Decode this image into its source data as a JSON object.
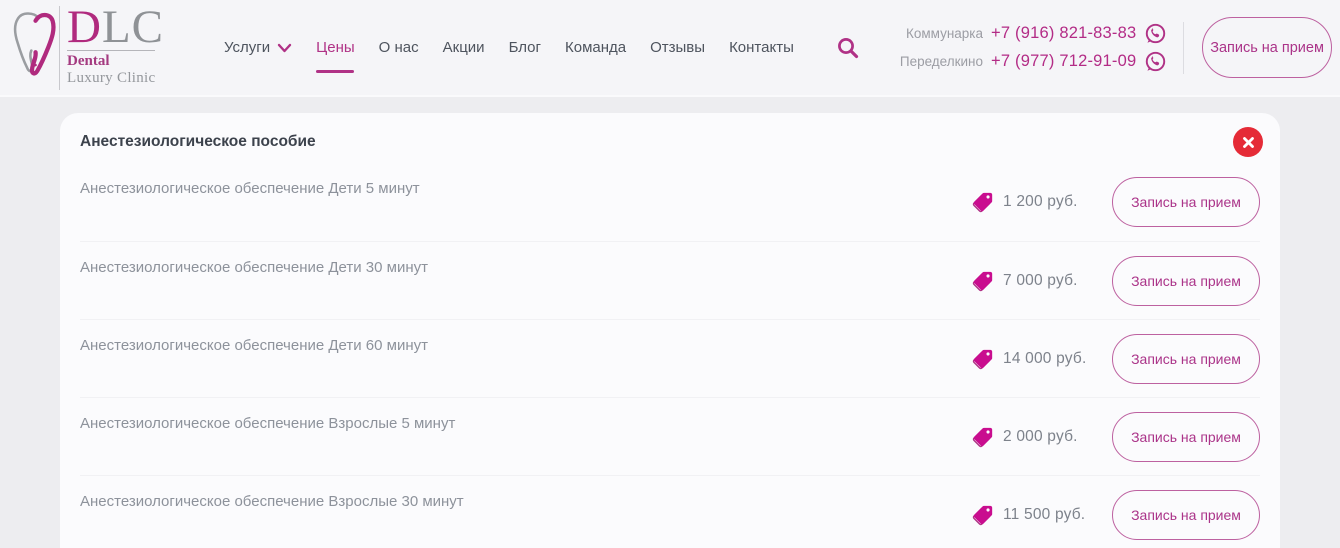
{
  "brand": {
    "abbr_first": "D",
    "abbr_rest": "LC",
    "tagline1": "Dental",
    "tagline2": "Luxury Clinic"
  },
  "nav": {
    "active": "Цены",
    "items": [
      {
        "label": "Услуги",
        "has_dropdown": true
      },
      {
        "label": "Цены"
      },
      {
        "label": "О нас"
      },
      {
        "label": "Акции"
      },
      {
        "label": "Блог"
      },
      {
        "label": "Команда"
      },
      {
        "label": "Отзывы"
      },
      {
        "label": "Контакты"
      }
    ]
  },
  "contacts": [
    {
      "location": "Коммунарка",
      "phone": "+7 (916) 821-83-83"
    },
    {
      "location": "Переделкино",
      "phone": "+7 (977) 712-91-09"
    }
  ],
  "header": {
    "cta": "Запись на прием"
  },
  "panel": {
    "title": "Анестезиологическое пособие",
    "rows": [
      {
        "name": "Анестезиологическое обеспечение Дети 5 минут",
        "price": "1 200 руб.",
        "cta": "Запись на прием"
      },
      {
        "name": "Анестезиологическое обеспечение Дети 30 минут",
        "price": "7 000 руб.",
        "cta": "Запись на прием"
      },
      {
        "name": "Анестезиологическое обеспечение Дети 60 минут",
        "price": "14 000 руб.",
        "cta": "Запись на прием"
      },
      {
        "name": "Анестезиологическое обеспечение Взрослые 5 минут",
        "price": "2 000 руб.",
        "cta": "Запись на прием"
      },
      {
        "name": "Анестезиологическое обеспечение Взрослые 30 минут",
        "price": "11 500 руб.",
        "cta": "Запись на прием"
      }
    ]
  },
  "icons": {
    "tooth": "tooth-logo",
    "chevron": "chevron-down",
    "search": "magnifier",
    "whatsapp": "whatsapp",
    "close": "x-in-red-circle",
    "price_tag": "double-price-tags"
  },
  "colors": {
    "accent": "#b03286",
    "logo_magenta": "#b02a7e",
    "close_red": "#e52b37",
    "header_bg": "#f5f5f8",
    "page_bg": "#ededf0",
    "panel_bg": "#fbfbfd",
    "text_dark": "#3c424c",
    "text_gray": "#8d929b"
  }
}
